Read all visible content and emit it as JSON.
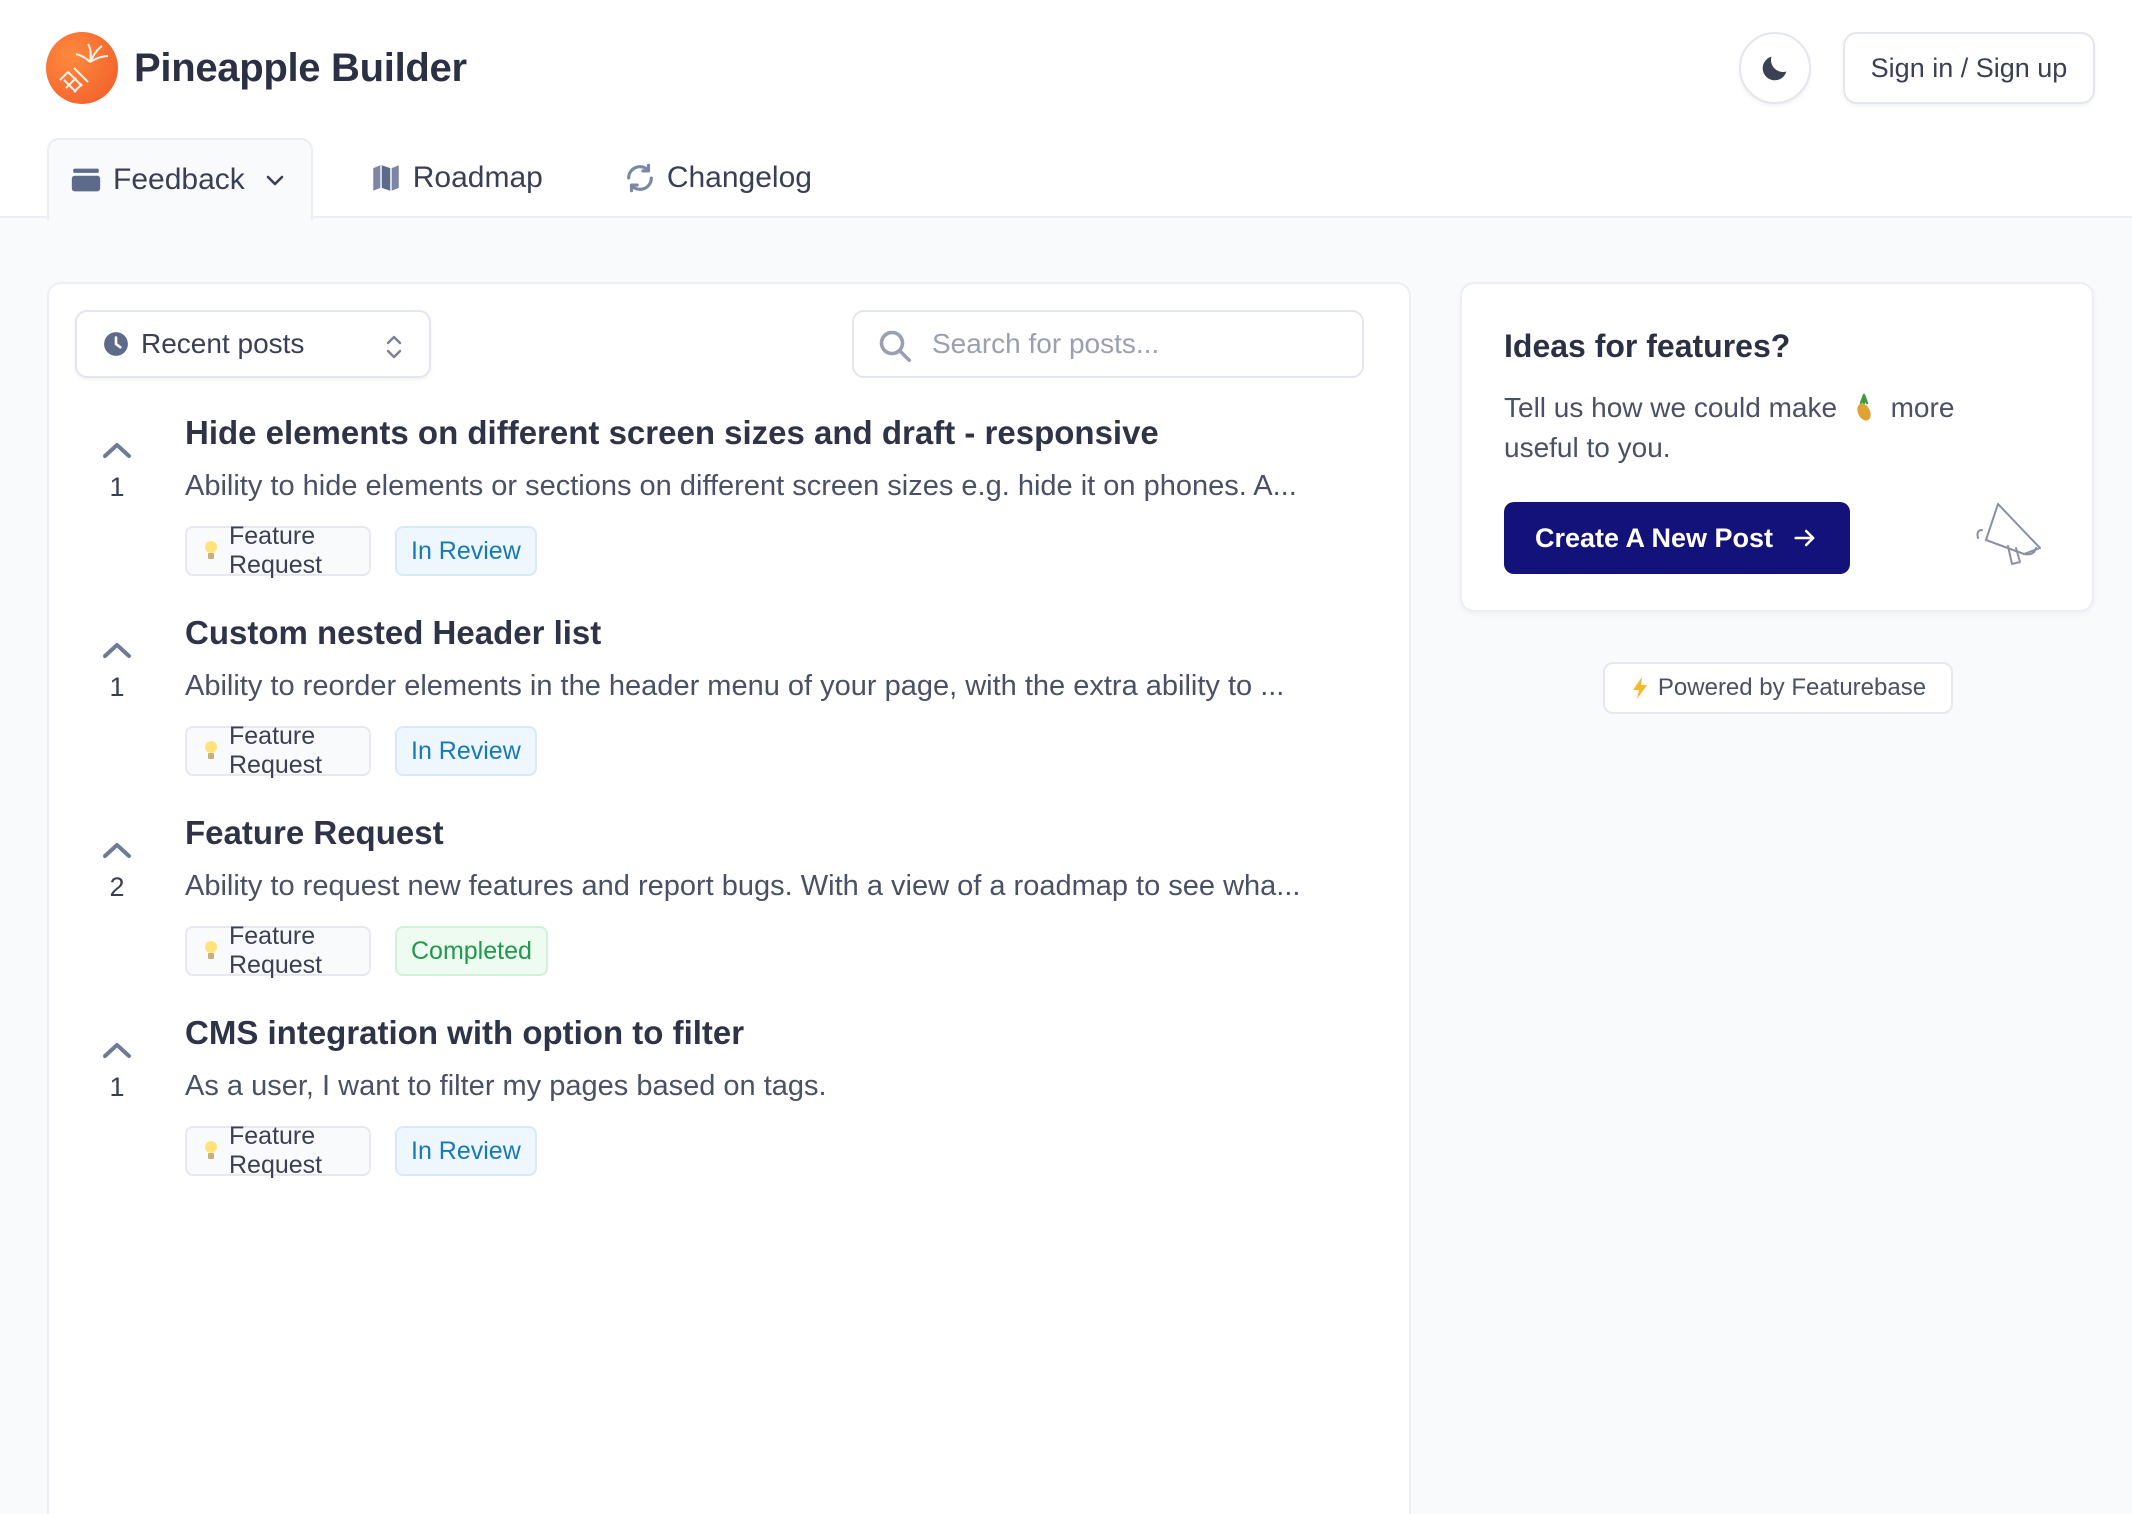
{
  "brand": {
    "name": "Pineapple Builder"
  },
  "header": {
    "signin_label": "Sign in / Sign up"
  },
  "tabs": [
    {
      "label": "Feedback",
      "icon": "feedback-icon",
      "active": true
    },
    {
      "label": "Roadmap",
      "icon": "roadmap-icon",
      "active": false
    },
    {
      "label": "Changelog",
      "icon": "changelog-icon",
      "active": false
    }
  ],
  "toolbar": {
    "sort_label": "Recent posts",
    "search_placeholder": "Search for posts..."
  },
  "posts": [
    {
      "title": "Hide elements on different screen sizes and draft - responsive",
      "description": "Ability to hide elements or sections on different screen sizes e.g. hide it on phones. A...",
      "votes": "1",
      "category": "Feature Request",
      "status": "In Review"
    },
    {
      "title": "Custom nested Header list",
      "description": "Ability to reorder elements in the header menu of your page, with the extra ability to ...",
      "votes": "1",
      "category": "Feature Request",
      "status": "In Review"
    },
    {
      "title": "Feature Request",
      "description": "Ability to request new features and report bugs. With a view of a roadmap to see wha...",
      "votes": "2",
      "category": "Feature Request",
      "status": "Completed"
    },
    {
      "title": "CMS integration with option to filter",
      "description": "As a user, I want to filter my pages based on tags.",
      "votes": "1",
      "category": "Feature Request",
      "status": "In Review"
    }
  ],
  "sidebar": {
    "title": "Ideas for features?",
    "text_before": "Tell us how we could make",
    "text_after": "more useful to you.",
    "create_label": "Create A New Post",
    "powered_label": "Powered by Featurebase"
  },
  "colors": {
    "primary": "#12127a",
    "brand_orange": "#f26b2e",
    "review": "#1878b8",
    "completed": "#1f9a4b"
  }
}
